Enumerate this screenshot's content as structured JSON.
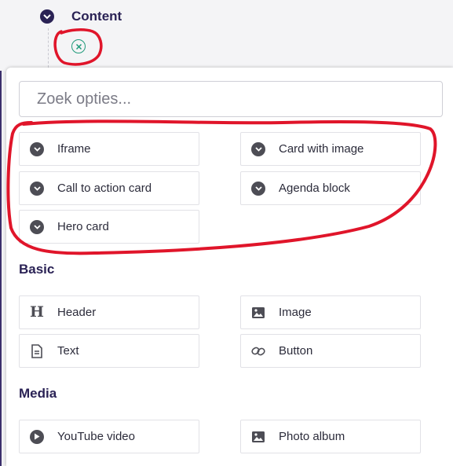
{
  "tree": {
    "section_label": "Content"
  },
  "search": {
    "placeholder": "Zoek opties..."
  },
  "custom_options": [
    {
      "label": "Iframe",
      "icon": "chevron-down-circle-icon"
    },
    {
      "label": "Card with image",
      "icon": "chevron-down-circle-icon"
    },
    {
      "label": "Call to action card",
      "icon": "chevron-down-circle-icon"
    },
    {
      "label": "Agenda block",
      "icon": "chevron-down-circle-icon"
    },
    {
      "label": "Hero card",
      "icon": "chevron-down-circle-icon"
    }
  ],
  "basic": {
    "title": "Basic",
    "items": [
      {
        "label": "Header",
        "icon": "heading-icon"
      },
      {
        "label": "Image",
        "icon": "image-icon"
      },
      {
        "label": "Text",
        "icon": "document-icon"
      },
      {
        "label": "Button",
        "icon": "link-icon"
      }
    ]
  },
  "media": {
    "title": "Media",
    "items": [
      {
        "label": "YouTube video",
        "icon": "play-circle-icon"
      },
      {
        "label": "Photo album",
        "icon": "image-icon"
      }
    ]
  },
  "colors": {
    "brand": "#2a2255",
    "accent_add": "#1f9a7a",
    "annotation": "#e0152a"
  }
}
